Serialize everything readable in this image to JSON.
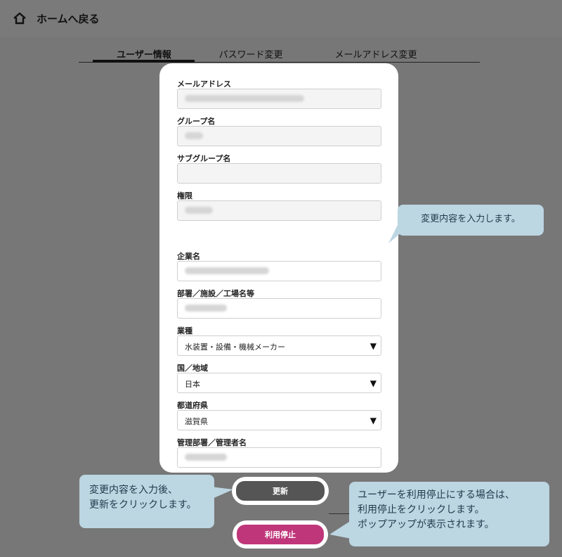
{
  "header": {
    "home_label": "ホームへ戻る"
  },
  "tabs": [
    {
      "label": "ユーザー情報",
      "active": true
    },
    {
      "label": "パスワード変更",
      "active": false
    },
    {
      "label": "メールアドレス変更",
      "active": false
    }
  ],
  "form": {
    "email_label": "メールアドレス",
    "group_label": "グループ名",
    "subgroup_label": "サブグループ名",
    "permission_label": "権限",
    "company_label": "企業名",
    "department_label": "部署／施設／工場名等",
    "industry_label": "業種",
    "industry_value": "水装置・設備・機械メーカー",
    "country_label": "国／地域",
    "country_value": "日本",
    "prefecture_label": "都道府県",
    "prefecture_value": "滋賀県",
    "manager_label": "管理部署／管理者名"
  },
  "buttons": {
    "update_label": "更新",
    "suspend_label": "利用停止"
  },
  "callouts": {
    "input_hint": "変更内容を入力します。",
    "update_hint_line1": "変更内容を入力後、",
    "update_hint_line2": "更新をクリックします。",
    "suspend_hint_line1": "ユーザーを利用停止にする場合は、",
    "suspend_hint_line2": "利用停止をクリックします。",
    "suspend_hint_line3": "ポップアップが表示されます。"
  },
  "colors": {
    "update_button": "#555555",
    "suspend_button": "#c0367a",
    "callout_bg": "#bcd6e2",
    "overlay": "#777777"
  },
  "icons": {
    "home": "home-icon",
    "dropdown": "triangle-down-icon"
  }
}
